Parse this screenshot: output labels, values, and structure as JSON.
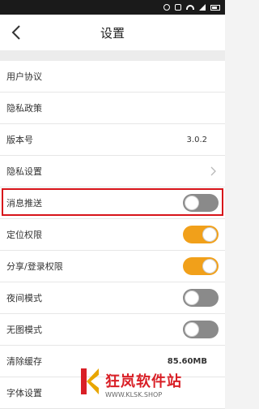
{
  "header": {
    "title": "设置"
  },
  "rows": [
    {
      "label": "用户协议"
    },
    {
      "label": "隐私政策"
    },
    {
      "label": "版本号",
      "value": "3.0.2"
    },
    {
      "label": "隐私设置"
    },
    {
      "label": "消息推送",
      "toggle": "off"
    },
    {
      "label": "定位权限",
      "toggle": "on"
    },
    {
      "label": "分享/登录权限",
      "toggle": "on"
    },
    {
      "label": "夜间模式",
      "toggle": "off"
    },
    {
      "label": "无图模式",
      "toggle": "off"
    },
    {
      "label": "清除缓存",
      "value": "85.60MB"
    },
    {
      "label": "字体设置"
    }
  ],
  "watermark": {
    "brand": "狂岚软件站",
    "url": "WWW.KLSK.SHOP"
  },
  "colors": {
    "accent": "#f1a01a",
    "highlight": "#d7141a",
    "brand_red": "#d91f26"
  }
}
